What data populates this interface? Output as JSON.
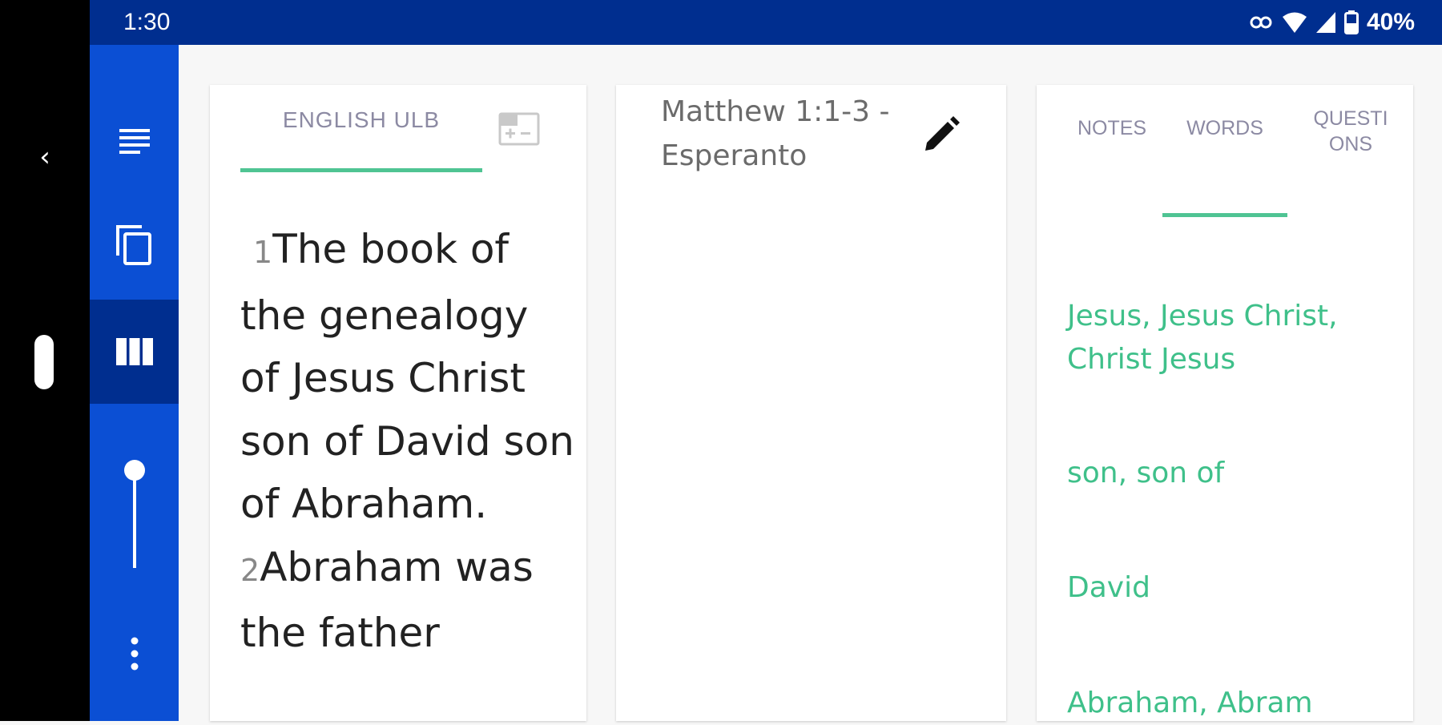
{
  "statusbar": {
    "time": "1:30",
    "battery": "40%"
  },
  "sysnav": {
    "back_icon": "chevron-left-icon",
    "home_icon": "home-pill-icon"
  },
  "rail": {
    "items": [
      {
        "icon": "list-lines-icon",
        "active": false
      },
      {
        "icon": "copy-icon",
        "active": false
      },
      {
        "icon": "columns-icon",
        "active": true
      },
      {
        "icon": "slider-icon",
        "active": false
      },
      {
        "icon": "more-vertical-icon",
        "active": false
      }
    ]
  },
  "source": {
    "tab_label": "ENGLISH ULB",
    "verses": [
      {
        "number": "1",
        "text": "The book of the genealogy of Jesus Christ son of David son of Abraham."
      },
      {
        "number": "2",
        "text": "Abraham was the father"
      }
    ]
  },
  "target": {
    "title": "Matthew 1:1-3 - Esperanto"
  },
  "resources": {
    "tabs": [
      {
        "label": "NOTES",
        "active": false
      },
      {
        "label": "WORDS",
        "active": true
      },
      {
        "label": "QUESTI ONS",
        "active": false
      }
    ],
    "words": [
      "Jesus, Jesus Christ, Christ Jesus",
      "son, son of",
      "David",
      "Abraham, Abram"
    ]
  },
  "colors": {
    "accent": "#4fc493",
    "word_link": "#3fc08a",
    "rail": "#0b4fd4",
    "statusbar": "#002e8f"
  }
}
